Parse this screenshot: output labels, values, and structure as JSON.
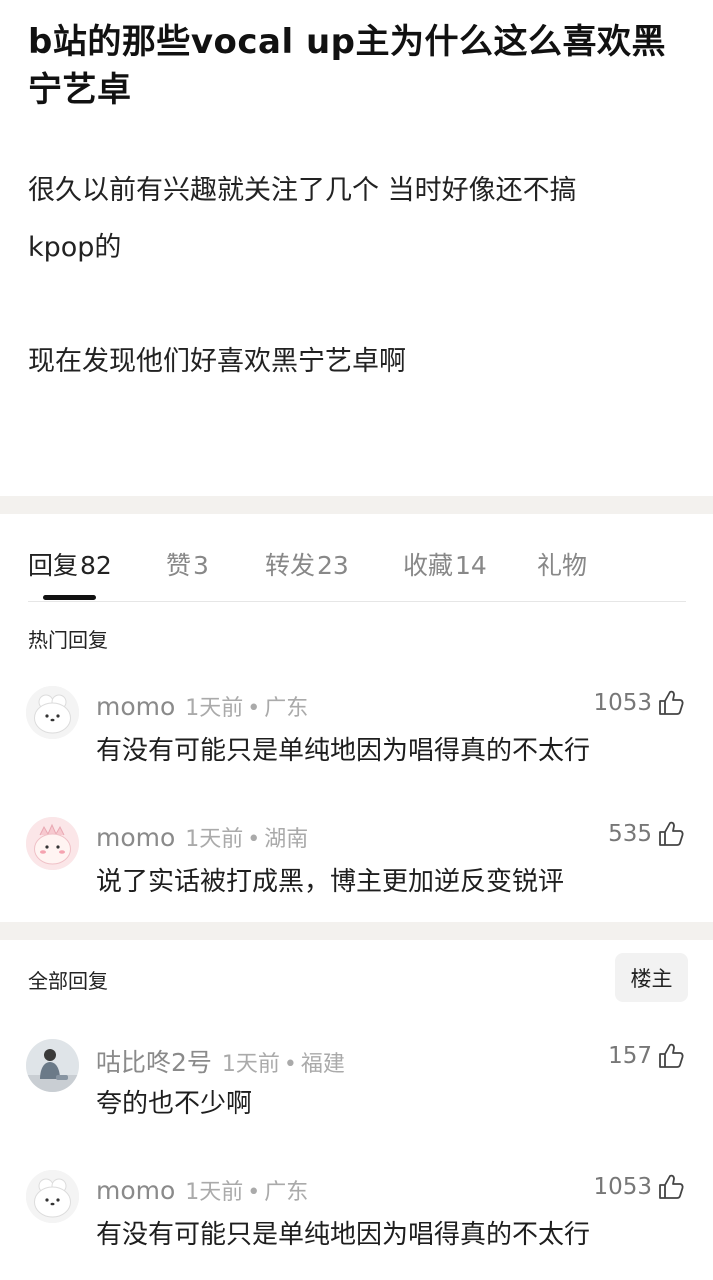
{
  "post": {
    "title": "b站的那些vocal up主为什么这么喜欢黑宁艺卓",
    "body_line1": "很久以前有兴趣就关注了几个 当时好像还不搞",
    "body_line2": "kpop的",
    "body_line3": "现在发现他们好喜欢黑宁艺卓啊"
  },
  "tabs": [
    {
      "label": "回复",
      "count": "82",
      "active": true
    },
    {
      "label": "赞",
      "count": "3"
    },
    {
      "label": "转发",
      "count": "23"
    },
    {
      "label": "收藏",
      "count": "14"
    },
    {
      "label": "礼物",
      "count": ""
    }
  ],
  "hot_section": {
    "label": "热门回复"
  },
  "all_section": {
    "label": "全部回复",
    "op_button": "楼主"
  },
  "hot_comments": [
    {
      "name": "momo",
      "time": "1天前",
      "dot": "•",
      "location": "广东",
      "likes": "1053",
      "text": "有没有可能只是单纯地因为唱得真的不太行",
      "avatar": "white-cartoon-avatar"
    },
    {
      "name": "momo",
      "time": "1天前",
      "dot": "•",
      "location": "湖南",
      "likes": "535",
      "text": "说了实话被打成黑，博主更加逆反变锐评",
      "avatar": "pink-cartoon-avatar"
    }
  ],
  "all_comments": [
    {
      "name": "咕比咚2号",
      "time": "1天前",
      "dot": "•",
      "location": "福建",
      "likes": "157",
      "text": "夸的也不少啊",
      "avatar": "photo-avatar"
    },
    {
      "name": "momo",
      "time": "1天前",
      "dot": "•",
      "location": "广东",
      "likes": "1053",
      "text": "有没有可能只是单纯地因为唱得真的不太行",
      "avatar": "white-cartoon-avatar"
    }
  ],
  "colors": {
    "band": "#f3f1ee",
    "muted": "#8a8a8a",
    "text": "#1e1e1e"
  }
}
